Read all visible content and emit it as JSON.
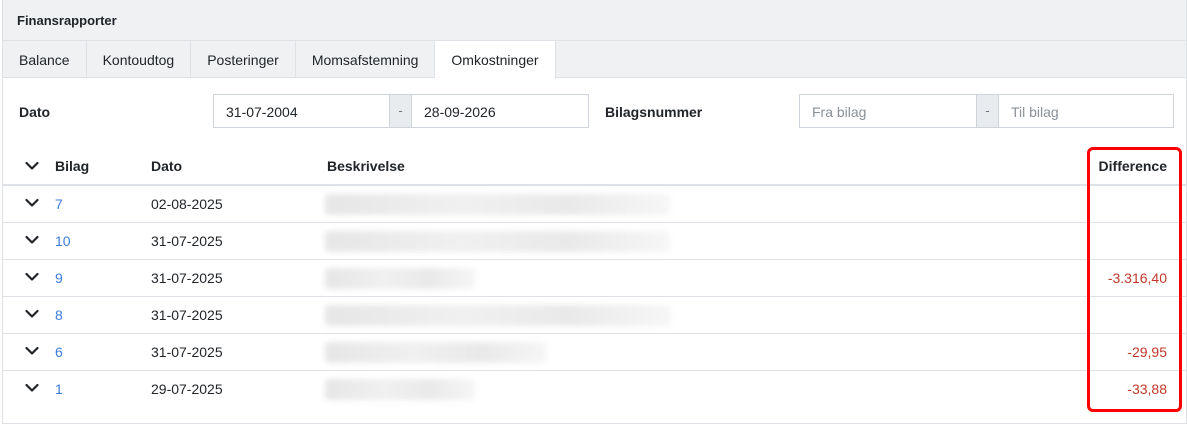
{
  "header": {
    "title": "Finansrapporter"
  },
  "tabs": [
    "Balance",
    "Kontoudtog",
    "Posteringer",
    "Momsafstemning",
    "Omkostninger"
  ],
  "active_tab": "Omkostninger",
  "filters": {
    "date_label": "Dato",
    "date_from": "31-07-2004",
    "date_separator": "-",
    "date_to": "28-09-2026",
    "voucher_label": "Bilagsnummer",
    "voucher_from_placeholder": "Fra bilag",
    "voucher_separator": "-",
    "voucher_to_placeholder": "Til bilag"
  },
  "table": {
    "columns": {
      "bilag": "Bilag",
      "dato": "Dato",
      "beskrivelse": "Beskrivelse",
      "difference": "Difference"
    },
    "rows": [
      {
        "bilag": "7",
        "dato": "02-08-2025",
        "difference": ""
      },
      {
        "bilag": "10",
        "dato": "31-07-2025",
        "difference": ""
      },
      {
        "bilag": "9",
        "dato": "31-07-2025",
        "difference": "-3.316,40"
      },
      {
        "bilag": "8",
        "dato": "31-07-2025",
        "difference": ""
      },
      {
        "bilag": "6",
        "dato": "31-07-2025",
        "difference": "-29,95"
      },
      {
        "bilag": "1",
        "dato": "29-07-2025",
        "difference": "-33,88"
      }
    ]
  },
  "colors": {
    "link": "#3b7ddd",
    "negative": "#c0392b",
    "highlight": "#ff0000"
  }
}
